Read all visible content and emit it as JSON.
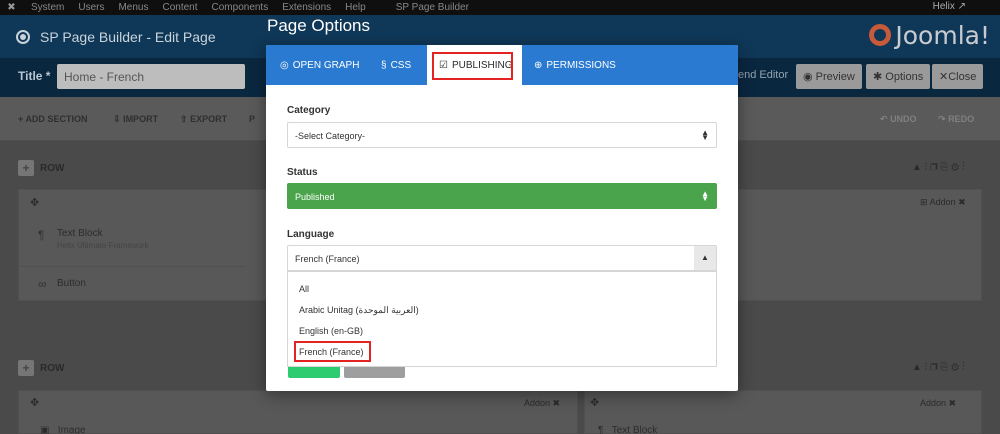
{
  "topnav": {
    "items": [
      "System",
      "Users",
      "Menus",
      "Content",
      "Components",
      "Extensions",
      "Help",
      "SP Page Builder"
    ],
    "right": "Helix"
  },
  "header": {
    "title": "SP Page Builder - Edit Page",
    "brand": "Joomla!"
  },
  "titlebar": {
    "label": "Title *",
    "value": "Home - French",
    "frontend_label": "end Editor",
    "preview": "Preview",
    "options": "Options",
    "close": "Close"
  },
  "toolbar": {
    "add_section": "ADD SECTION",
    "import": "IMPORT",
    "export": "EXPORT",
    "p": "P",
    "undo": "UNDO",
    "redo": "REDO"
  },
  "rows": [
    {
      "label": "ROW",
      "addon_label": "Addon",
      "items": [
        {
          "title": "Text Block",
          "subtitle": "Helix Ultimate Framework"
        },
        {
          "title": "Button",
          "subtitle": ""
        }
      ]
    },
    {
      "label": "ROW",
      "addon_label": "Addon",
      "items": [
        {
          "title": "Image",
          "subtitle": ""
        },
        {
          "title": "Text Block",
          "subtitle": ""
        }
      ],
      "addon_label_2": "Addon"
    }
  ],
  "modal": {
    "title": "Page Options",
    "tabs": [
      {
        "label": "OPEN GRAPH",
        "icon": "open-graph-icon"
      },
      {
        "label": "CSS",
        "icon": "css-icon"
      },
      {
        "label": "PUBLISHING",
        "icon": "calendar-check-icon"
      },
      {
        "label": "PERMISSIONS",
        "icon": "globe-icon"
      }
    ],
    "active_tab": "PUBLISHING",
    "category": {
      "label": "Category",
      "value": "-Select Category-"
    },
    "status": {
      "label": "Status",
      "value": "Published"
    },
    "language": {
      "label": "Language",
      "value": "French (France)",
      "options": [
        "All",
        "Arabic Unitag (العربية الموحدة)",
        "English (en-GB)",
        "French (France)"
      ],
      "highlighted": "French (France)"
    }
  },
  "colors": {
    "tab_bar": "#2b7ad1",
    "status_green": "#4aa44c",
    "highlight_red": "#e32222",
    "header_navy": "#0f3757"
  }
}
